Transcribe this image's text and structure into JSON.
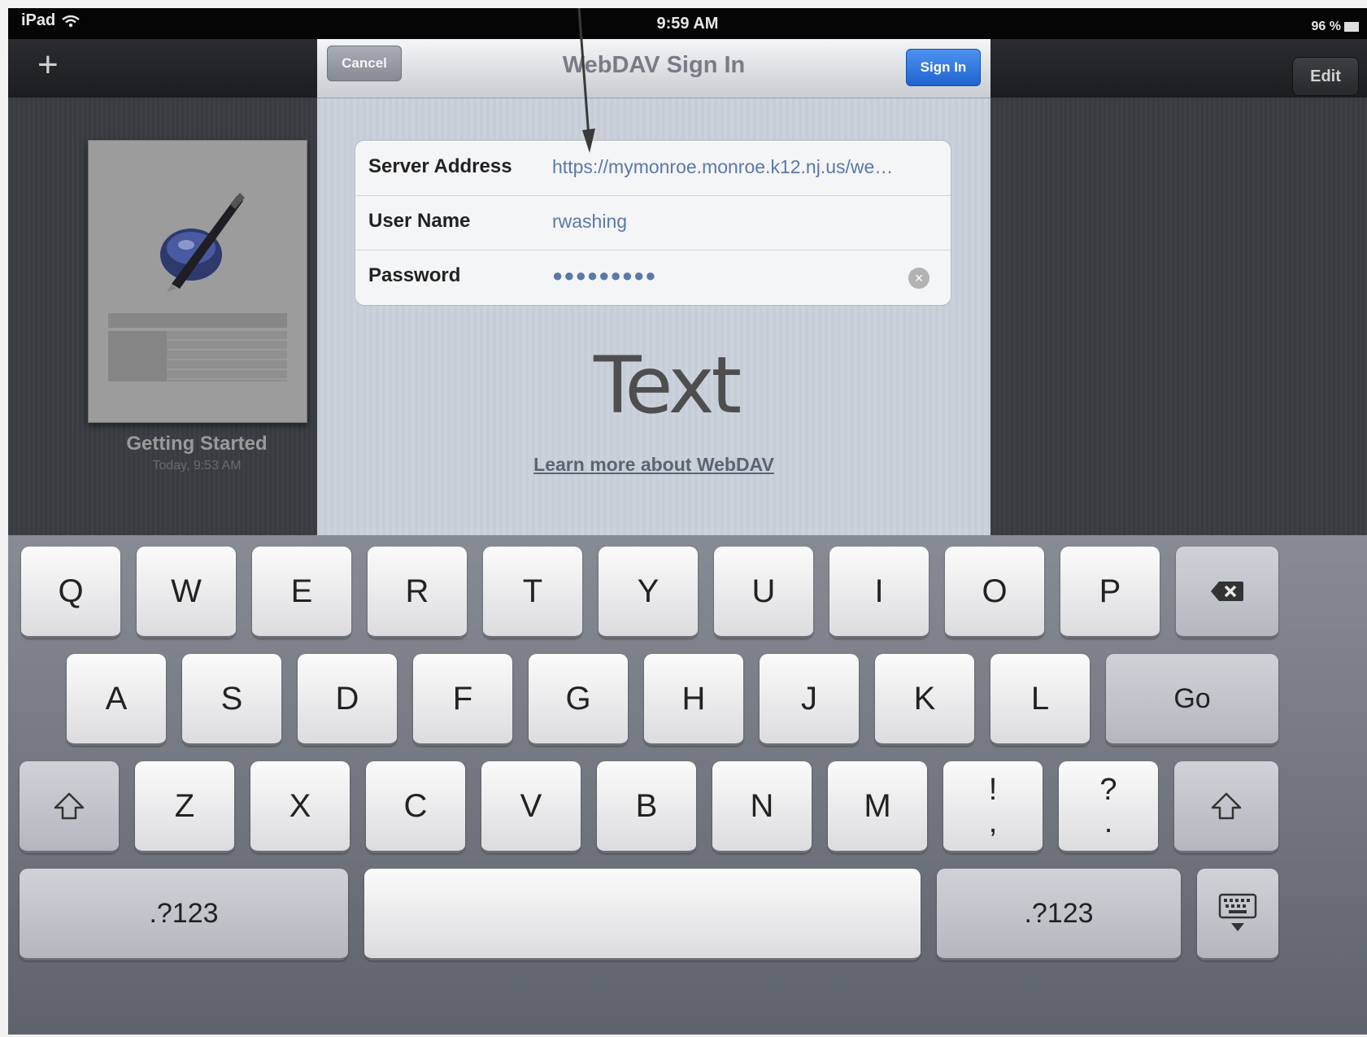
{
  "status_bar": {
    "device": "iPad",
    "time": "9:59 AM",
    "battery": "96 %"
  },
  "nav_bar": {
    "add_label": "+",
    "edit_label": "Edit"
  },
  "document": {
    "title": "Getting Started",
    "date": "Today, 9:53 AM"
  },
  "dialog": {
    "cancel_label": "Cancel",
    "title": "WebDAV Sign In",
    "sign_in_label": "Sign In",
    "fields": [
      {
        "label": "Server Address",
        "value": "https://mymonroe.monroe.k12.nj.us/we…"
      },
      {
        "label": "User Name",
        "value": "rwashing"
      },
      {
        "label": "Password",
        "value": "●●●●●●●●●"
      }
    ],
    "annotation_text": "Text",
    "learn_more_link": "Learn more about WebDAV"
  },
  "keyboard": {
    "row1": [
      "Q",
      "W",
      "E",
      "R",
      "T",
      "Y",
      "U",
      "I",
      "O",
      "P"
    ],
    "row2": [
      "A",
      "S",
      "D",
      "F",
      "G",
      "H",
      "J",
      "K",
      "L"
    ],
    "row2_go": "Go",
    "row3": [
      "Z",
      "X",
      "C",
      "V",
      "B",
      "N",
      "M"
    ],
    "punct1": {
      "top": "!",
      "bottom": ","
    },
    "punct2": {
      "top": "?",
      "bottom": "."
    },
    "numbers_label": ".?123",
    "icons": {
      "delete": "backspace-icon",
      "shift": "shift-icon",
      "hide": "keyboard-hide-icon",
      "wifi": "wifi-icon",
      "clear": "clear-icon"
    }
  }
}
